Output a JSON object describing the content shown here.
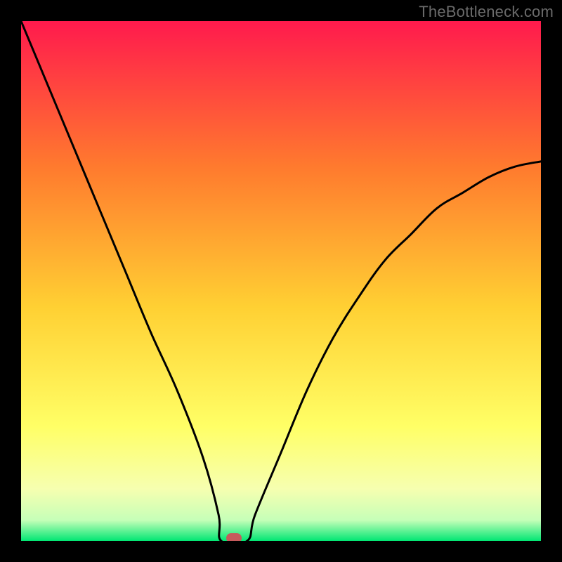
{
  "watermark": "TheBottleneck.com",
  "colors": {
    "frame": "#000000",
    "gradient_top": "#ff1a4d",
    "gradient_mid_upper": "#ff7a2e",
    "gradient_mid": "#ffd033",
    "gradient_mid_lower": "#ffff66",
    "gradient_low1": "#f6ffb0",
    "gradient_low2": "#c6ffb8",
    "gradient_bottom": "#00e673",
    "curve": "#000000",
    "marker": "#c65a5c"
  },
  "chart_data": {
    "type": "line",
    "title": "",
    "xlabel": "",
    "ylabel": "",
    "xlim": [
      0,
      100
    ],
    "ylim": [
      0,
      100
    ],
    "series": [
      {
        "name": "bottleneck-curve",
        "x": [
          0,
          5,
          10,
          15,
          20,
          25,
          30,
          35,
          38,
          40,
          42,
          45,
          50,
          55,
          60,
          65,
          70,
          75,
          80,
          85,
          90,
          95,
          100
        ],
        "y": [
          100,
          88,
          76,
          64,
          52,
          40,
          29,
          16,
          5,
          0,
          0,
          5,
          17,
          29,
          39,
          47,
          54,
          59,
          64,
          67,
          70,
          72,
          73
        ]
      }
    ],
    "flat_region": {
      "x_start": 38.5,
      "x_end": 43.5,
      "y": 0
    },
    "marker": {
      "x": 41,
      "y": 0.5
    }
  }
}
